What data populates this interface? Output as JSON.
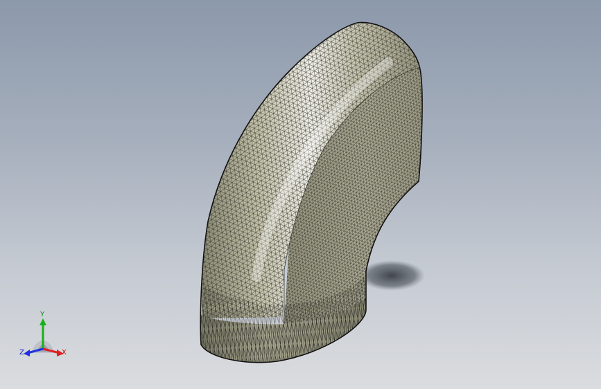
{
  "triad": {
    "x_label": "X",
    "y_label": "Y",
    "z_label": "Z",
    "x_color": "#e02020",
    "y_color": "#18b018",
    "z_color": "#2030e0"
  },
  "model": {
    "part_icon": "elbow-pipe-mesh-icon"
  }
}
